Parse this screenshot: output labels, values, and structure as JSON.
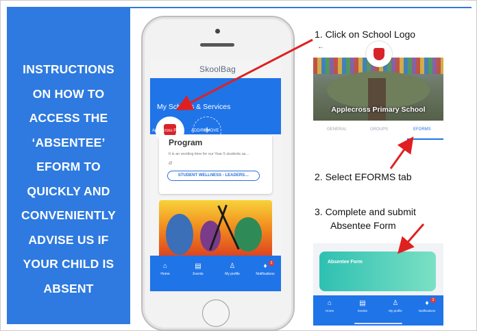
{
  "instructions_panel": {
    "lines": [
      "INSTRUCTIONS",
      "ON HOW TO",
      "ACCESS THE",
      "‘ABSENTEE’",
      "EFORM TO",
      "QUICKLY AND",
      "CONVENIENTLY",
      "ADVISE US IF",
      "YOUR CHILD IS",
      "ABSENT"
    ],
    "background": "#2e7ae0"
  },
  "phone_screen": {
    "app_logo": "SkoolBag",
    "section_title": "My Schools & Services",
    "school_label": "Applecross Pri…",
    "add_label": "ADD/REMOVE",
    "add_symbol": "+",
    "card_title": "Program",
    "card_desc": "It is an exciting time for our Year 5 students as…",
    "card_chip": "STUDENT WELLNESS - LEADERS…",
    "nav": [
      {
        "icon": "home-icon",
        "glyph": "⌂",
        "label": "Home"
      },
      {
        "icon": "eforms-icon",
        "glyph": "▤",
        "label": "Events"
      },
      {
        "icon": "profile-icon",
        "glyph": "♙",
        "label": "My profile"
      },
      {
        "icon": "bell-icon",
        "glyph": "🔔",
        "label": "Notifications",
        "badge": "2"
      }
    ]
  },
  "steps": {
    "step1": "1. Click on School Logo",
    "step2": "2. Select EFORMS tab",
    "step3_line1": "3. Complete and submit",
    "step3_line2": "Absentee Form"
  },
  "school_page": {
    "back_symbol": "←",
    "school_name": "Applecross Primary School",
    "tabs": [
      "GENERAL",
      "GROUPS",
      "EFORMS"
    ],
    "selected_tab": "EFORMS"
  },
  "form_screen": {
    "form_title": "Absentee Form",
    "nav": [
      {
        "icon": "home-icon",
        "glyph": "⌂",
        "label": "Home"
      },
      {
        "icon": "eforms-icon",
        "glyph": "▤",
        "label": "Events"
      },
      {
        "icon": "profile-icon",
        "glyph": "♙",
        "label": "My profile"
      },
      {
        "icon": "bell-icon",
        "glyph": "🔔",
        "label": "Notifications",
        "badge": "2"
      }
    ]
  },
  "colors": {
    "accent_blue": "#1f74e8",
    "arrow_red": "#e02020",
    "crest_red": "#d8232a"
  }
}
